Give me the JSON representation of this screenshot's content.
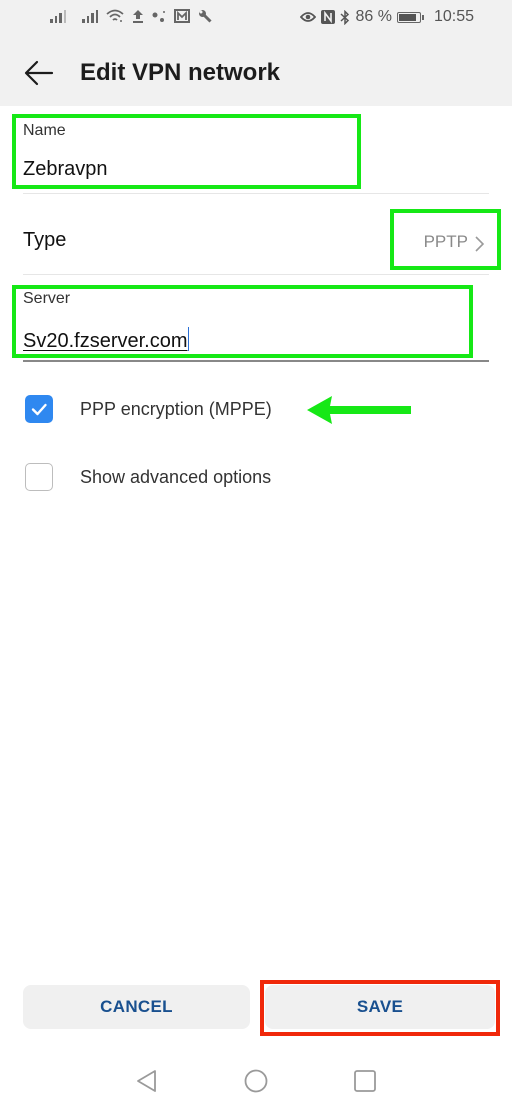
{
  "status_bar": {
    "left_icons": [
      "signal-icon",
      "signal-icon",
      "wifi-icon",
      "upload-icon",
      "dots-icon",
      "gallery-icon",
      "wrench-icon"
    ],
    "right_icons": [
      "eye-icon",
      "nfc-icon",
      "bluetooth-icon"
    ],
    "battery_percent": "86 %",
    "battery_level": 0.86,
    "time": "10:55"
  },
  "app_bar": {
    "title": "Edit VPN network"
  },
  "form": {
    "name": {
      "label": "Name",
      "value": "Zebravpn"
    },
    "type": {
      "label": "Type",
      "value": "PPTP"
    },
    "server": {
      "label": "Server",
      "value": "Sv20.fzserver.com"
    },
    "options": [
      {
        "label": "PPP encryption (MPPE)",
        "checked": true
      },
      {
        "label": "Show advanced options",
        "checked": false
      }
    ]
  },
  "buttons": {
    "cancel": "CANCEL",
    "save": "SAVE"
  },
  "annotations": {
    "highlight_color": "#16e816",
    "save_highlight_color": "#f0280a"
  },
  "nav_bar": [
    "back-icon",
    "home-icon",
    "recents-icon"
  ]
}
